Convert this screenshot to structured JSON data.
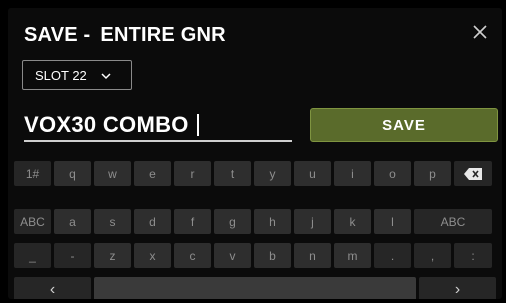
{
  "header": {
    "title_prefix": "SAVE -",
    "title_name": "ENTIRE GNR",
    "close_icon": "close-icon"
  },
  "slot_select": {
    "value": "SLOT 22",
    "icon": "chevron-down-icon"
  },
  "name_input": {
    "value": "VOX30 COMBO"
  },
  "save_button": {
    "label": "SAVE",
    "color": "#5a6b2b"
  },
  "keyboard": {
    "row1": [
      "1#",
      "q",
      "w",
      "e",
      "r",
      "t",
      "y",
      "u",
      "i",
      "o",
      "p"
    ],
    "row2": [
      "ABC",
      "a",
      "s",
      "d",
      "f",
      "g",
      "h",
      "j",
      "k",
      "l",
      "ABC"
    ],
    "row3": [
      "_",
      "-",
      "z",
      "x",
      "c",
      "v",
      "b",
      "n",
      "m",
      ".",
      ",",
      ":"
    ],
    "backspace_icon": "backspace-icon",
    "left_arrow_label": "‹",
    "right_arrow_label": "›"
  }
}
